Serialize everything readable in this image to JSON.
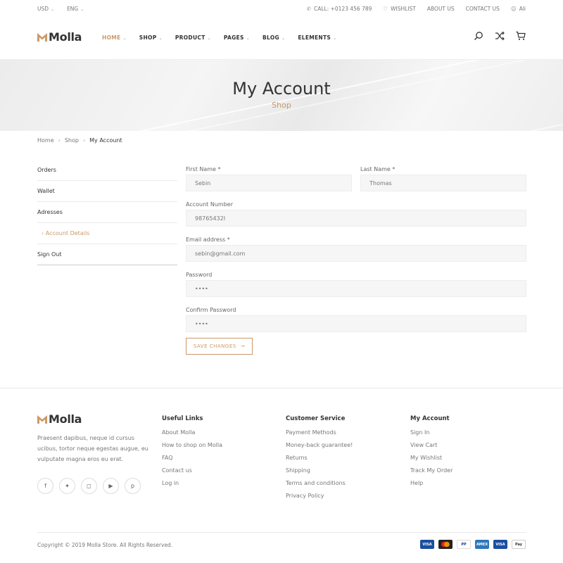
{
  "topbar": {
    "currency": "USD",
    "language": "ENG",
    "phone": "Call: +0123 456 789",
    "wishlist": "Wishlist",
    "about": "About Us",
    "contact": "Contact Us",
    "user": "Ali"
  },
  "header": {
    "logo": "Molla",
    "nav": [
      "HOME",
      "SHOP",
      "PRODUCT",
      "PAGES",
      "BLOG",
      "ELEMENTS"
    ]
  },
  "hero": {
    "title": "My Account",
    "subtitle": "Shop"
  },
  "breadcrumb": [
    "Home",
    "Shop",
    "My Account"
  ],
  "sidebar": {
    "items": [
      {
        "label": "Orders"
      },
      {
        "label": "Wallet"
      },
      {
        "label": "Adresses"
      },
      {
        "label": "Account Details"
      },
      {
        "label": "Sign Out"
      }
    ]
  },
  "form": {
    "first_name_label": "First Name *",
    "first_name_value": "Sebin",
    "last_name_label": "Last Name *",
    "last_name_value": "Thomas",
    "account_label": "Account Number",
    "account_value": "98765432I",
    "email_label": "Email address *",
    "email_value": "sebin@gmail.com",
    "password_label": "Password",
    "password_value": "••••",
    "confirm_label": "Confirm Password",
    "confirm_value": "••••",
    "save_label": "SAVE CHANGES"
  },
  "footer": {
    "logo": "Molla",
    "about": "Praesent dapibus, neque id cursus ucibus, tortor neque egestas augue, eu vulputate magna eros eu erat.",
    "useful_title": "Useful Links",
    "useful_links": [
      "About Molla",
      "How to shop on Molla",
      "FAQ",
      "Contact us",
      "Log in"
    ],
    "service_title": "Customer Service",
    "service_links": [
      "Payment Methods",
      "Money-back guarantee!",
      "Returns",
      "Shipping",
      "Terms and conditions",
      "Privacy Policy"
    ],
    "account_title": "My Account",
    "account_links": [
      "Sign In",
      "View Cart",
      "My Wishlist",
      "Track My Order",
      "Help"
    ],
    "copyright": "Copyright © 2019 Molla Store. All Rights Reserved.",
    "payments": [
      "VISA",
      "MC",
      "PP",
      "AMEX",
      "VISA",
      "Pay"
    ]
  },
  "colors": {
    "accent": "#cc9966",
    "text": "#333333",
    "muted": "#777777"
  }
}
